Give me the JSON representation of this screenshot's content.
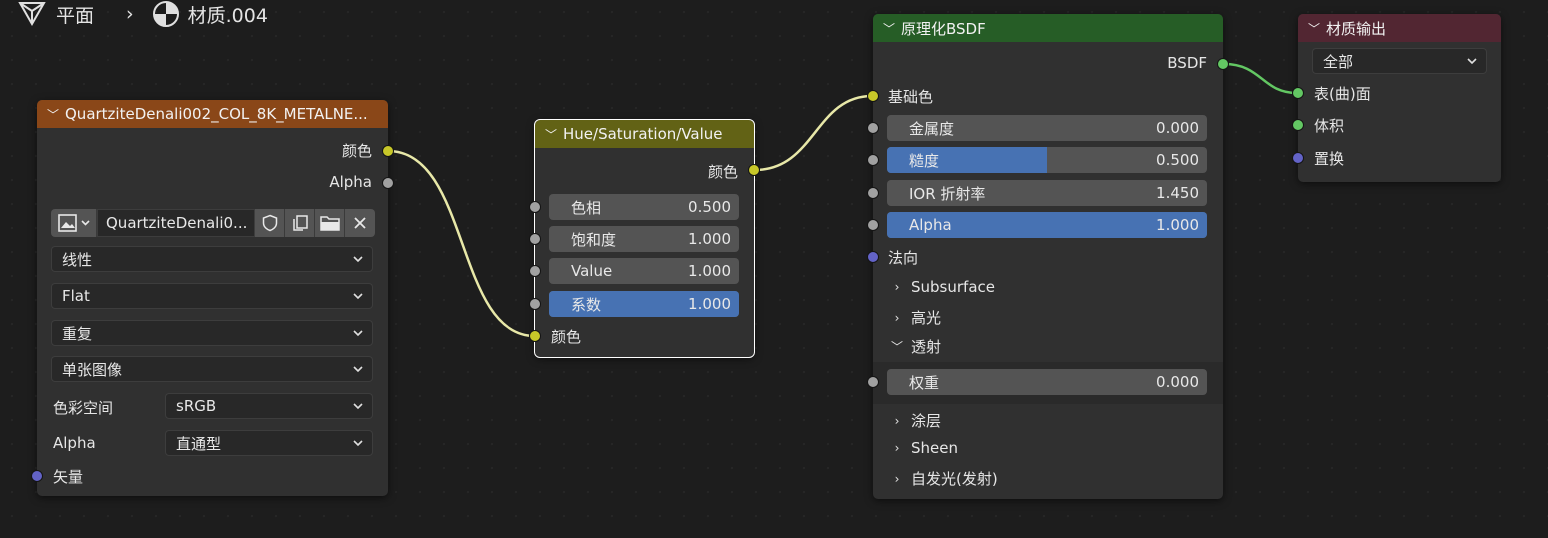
{
  "breadcrumb": {
    "object": "平面",
    "separator": "›",
    "material": "材质.004"
  },
  "colors": {
    "image_header": "#8a4718",
    "hsv_header": "#626215",
    "bsdf_header": "#265d26",
    "output_header": "#522632",
    "link": "#e8e8a8",
    "link_green": "#63c763",
    "socket_yellow": "#c7c729",
    "socket_grey": "#a1a1a1",
    "socket_purple": "#6363c7",
    "socket_green": "#63c763",
    "field_blue": "#4772b3"
  },
  "image_node": {
    "title": "QuartziteDenali002_COL_8K_METALNE...",
    "out_color": "颜色",
    "out_alpha": "Alpha",
    "image_name": "QuartziteDenali0...",
    "interpolation": "线性",
    "projection": "Flat",
    "extension": "重复",
    "source": "单张图像",
    "colorspace_label": "色彩空间",
    "colorspace_value": "sRGB",
    "alpha_label": "Alpha",
    "alpha_value": "直通型",
    "in_vector": "矢量"
  },
  "hsv_node": {
    "title": "Hue/Saturation/Value",
    "out_color": "颜色",
    "hue_label": "色相",
    "hue_value": "0.500",
    "sat_label": "饱和度",
    "sat_value": "1.000",
    "val_label": "Value",
    "val_value": "1.000",
    "fac_label": "系数",
    "fac_value": "1.000",
    "fac_fraction": 1.0,
    "in_color": "颜色"
  },
  "bsdf_node": {
    "title": "原理化BSDF",
    "out_bsdf": "BSDF",
    "base_color": "基础色",
    "metallic_label": "金属度",
    "metallic_value": "0.000",
    "metallic_fraction": 0.0,
    "roughness_label": "糙度",
    "roughness_value": "0.500",
    "roughness_fraction": 0.5,
    "ior_label": "IOR 折射率",
    "ior_value": "1.450",
    "alpha_label": "Alpha",
    "alpha_value": "1.000",
    "alpha_fraction": 1.0,
    "normal": "法向",
    "subsurface": "Subsurface",
    "specular": "高光",
    "transmission": "透射",
    "weight_label": "权重",
    "weight_value": "0.000",
    "weight_fraction": 0.0,
    "coat": "涂层",
    "sheen": "Sheen",
    "emission": "自发光(发射)"
  },
  "output_node": {
    "title": "材质输出",
    "target": "全部",
    "surface": "表(曲)面",
    "volume": "体积",
    "displacement": "置换"
  }
}
